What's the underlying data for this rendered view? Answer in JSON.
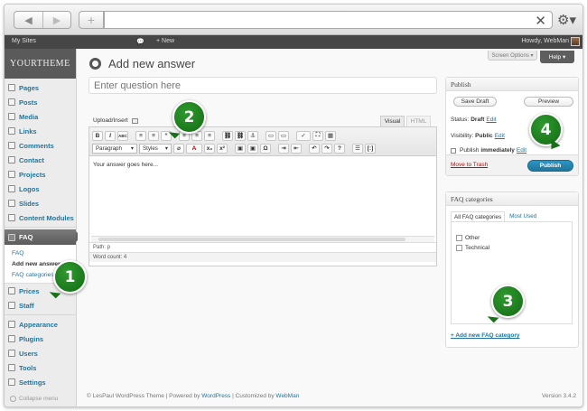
{
  "browser": {
    "back_icon": "◀",
    "forward_icon": "▶",
    "new_tab_icon": "+",
    "clear_icon": "✕",
    "gear_icon": "⚙▾"
  },
  "admin_bar": {
    "my_sites": "My Sites",
    "comment_icon": "💬",
    "new": "+ New",
    "howdy": "Howdy, WebMan"
  },
  "sidebar": {
    "brand": "YOURTHEME",
    "items_top": [
      {
        "label": "Pages"
      },
      {
        "label": "Posts"
      },
      {
        "label": "Media"
      },
      {
        "label": "Links"
      },
      {
        "label": "Comments"
      },
      {
        "label": "Contact"
      },
      {
        "label": "Projects"
      },
      {
        "label": "Logos"
      },
      {
        "label": "Slides"
      },
      {
        "label": "Content Modules"
      }
    ],
    "active": "FAQ",
    "submenu": [
      "FAQ",
      "Add new answer",
      "FAQ categories"
    ],
    "items_mid": [
      {
        "label": "Prices"
      },
      {
        "label": "Staff"
      }
    ],
    "items_bottom": [
      {
        "label": "Appearance"
      },
      {
        "label": "Plugins"
      },
      {
        "label": "Users"
      },
      {
        "label": "Tools"
      },
      {
        "label": "Settings"
      }
    ],
    "collapse": "Collapse menu"
  },
  "main": {
    "screen_options": "Screen Options ▾",
    "help": "Help ▾",
    "title": "Add new answer",
    "question_placeholder": "Enter question here",
    "upload_insert": "Upload/Insert",
    "tab_visual": "Visual",
    "tab_html": "HTML",
    "toolbar_row1": [
      "B",
      "I",
      "ABC",
      "≡",
      "≡",
      "“",
      "≡",
      "≡",
      "≡",
      "⛓",
      "⛓",
      "⚓",
      "▭",
      "▭",
      "✓",
      "⛶",
      "▦"
    ],
    "format_select": "Paragraph",
    "styles_select": "Styles",
    "toolbar_row2": [
      "⌀",
      "A",
      "x₂",
      "x²",
      "▣",
      "▣",
      "Ω",
      "⇥",
      "⇤",
      "↶",
      "↷",
      "?",
      "☰",
      "[:]"
    ],
    "editor_text": "Your answer goes here...",
    "path": "Path: p",
    "word_count": "Word count: 4"
  },
  "publish": {
    "title": "Publish",
    "save_draft": "Save Draft",
    "preview": "Preview",
    "status_label": "Status:",
    "status_value": "Draft",
    "visibility_label": "Visibility:",
    "visibility_value": "Public",
    "publish_label": "Publish",
    "publish_value": "immediately",
    "edit": "Edit",
    "trash": "Move to Trash",
    "publish_button": "Publish"
  },
  "faq_categories": {
    "title": "FAQ categories",
    "tab_all": "All FAQ categories",
    "tab_most_used": "Most Used",
    "categories": [
      "Other",
      "Technical"
    ],
    "add_new": "+ Add new FAQ category"
  },
  "footer": {
    "prefix": "© LesPaul WordPress Theme | Powered by ",
    "wordpress": "WordPress",
    "middle": " | Customized by ",
    "webman": "WebMan",
    "version": "Version 3.4.2"
  },
  "callouts": [
    "1",
    "2",
    "3",
    "4"
  ],
  "colors": {
    "accent_link": "#21759b",
    "callout_green": "#1e7e1e",
    "publish_blue": "#21759b"
  }
}
